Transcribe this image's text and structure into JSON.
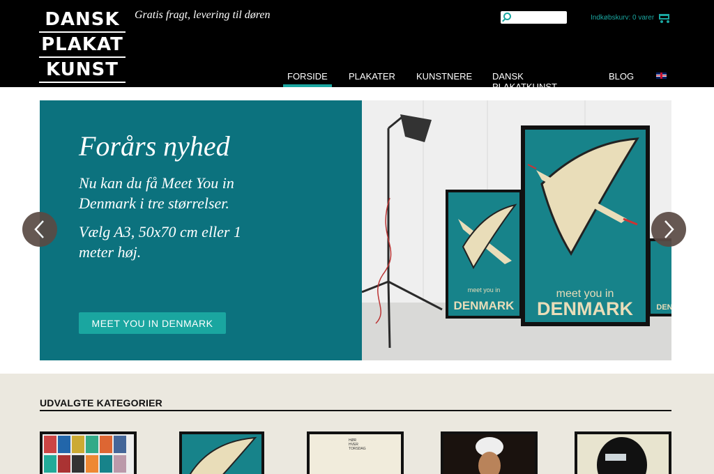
{
  "header": {
    "logo_lines": [
      "DANSK",
      "PLAKAT",
      "KUNST"
    ],
    "tagline": "Gratis fragt, levering til døren",
    "search": {
      "placeholder": "",
      "value": ""
    },
    "cart_text": "Indkøbskurv: 0 varer",
    "nav": [
      {
        "label": "FORSIDE",
        "active": true
      },
      {
        "label": "PLAKATER"
      },
      {
        "label": "KUNSTNERE"
      },
      {
        "label": "DANSK PLAKATKUNST"
      },
      {
        "label": "BLOG"
      }
    ],
    "language_icon": "uk-flag-icon"
  },
  "hero": {
    "title": "Forårs nyhed",
    "paragraph1": "Nu kan du få Meet You in Denmark i tre størrelser.",
    "paragraph2": "Vælg A3, 50x70 cm eller 1 meter høj.",
    "button_label": "MEET YOU IN DENMARK",
    "poster_text_top": "meet you in",
    "poster_text_bottom": "DENMARK"
  },
  "categories": {
    "title": "UDVALGTE KATEGORIER",
    "thumb3_text": [
      "HØR",
      "HVER",
      "TORSDAG"
    ]
  },
  "colors": {
    "accent": "#1aa6a0",
    "hero_panel": "#0c727e",
    "category_bg": "#ebe8df"
  }
}
